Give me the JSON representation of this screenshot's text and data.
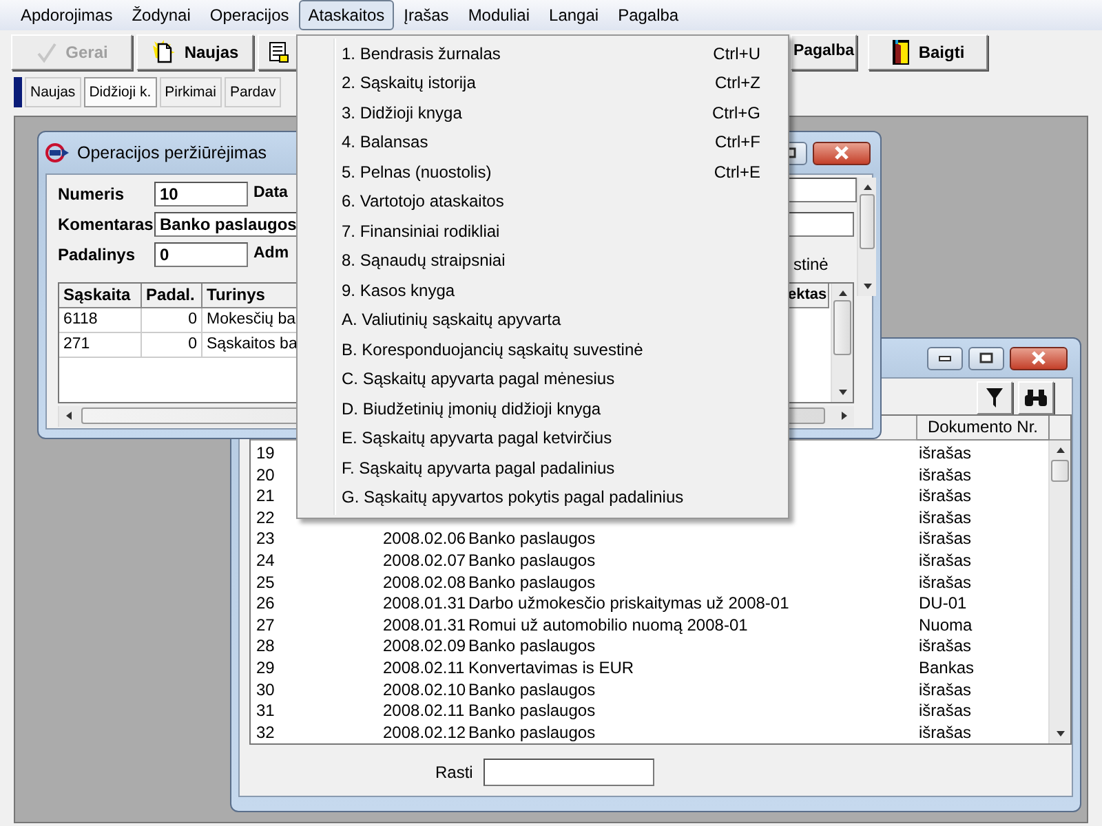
{
  "menu_bar": [
    {
      "label": "Apdorojimas",
      "selected": false
    },
    {
      "label": "Žodynai",
      "selected": false
    },
    {
      "label": "Operacijos",
      "selected": false
    },
    {
      "label": "Ataskaitos",
      "selected": true
    },
    {
      "label": "Įrašas",
      "selected": false
    },
    {
      "label": "Moduliai",
      "selected": false
    },
    {
      "label": "Langai",
      "selected": false
    },
    {
      "label": "Pagalba",
      "selected": false
    }
  ],
  "toolbar": [
    {
      "kind": "check",
      "label": "Gerai",
      "disabled": true
    },
    {
      "kind": "new",
      "label": "Naujas",
      "disabled": false
    },
    {
      "kind": "doc",
      "disabled": false
    },
    {
      "kind": "plain",
      "label": "Pagalba",
      "disabled": false
    },
    {
      "kind": "exit",
      "label": "Baigti",
      "disabled": false
    }
  ],
  "tabs": [
    {
      "label": "Naujas",
      "selected": false
    },
    {
      "label": "Didžioji k.",
      "selected": true
    },
    {
      "label": "Pirkimai",
      "selected": false
    },
    {
      "label": "Pardav",
      "selected": false
    }
  ],
  "report_menu": [
    {
      "label": "1. Bendrasis žurnalas",
      "shortcut": "Ctrl+U"
    },
    {
      "label": "2. Sąskaitų istorija",
      "shortcut": "Ctrl+Z"
    },
    {
      "label": "3. Didžioji knyga",
      "shortcut": "Ctrl+G"
    },
    {
      "label": "4. Balansas",
      "shortcut": "Ctrl+F"
    },
    {
      "label": "5. Pelnas (nuostolis)",
      "shortcut": "Ctrl+E"
    },
    {
      "label": "6. Vartotojo ataskaitos"
    },
    {
      "label": "7. Finansiniai rodikliai"
    },
    {
      "label": "8. Sąnaudų straipsniai"
    },
    {
      "label": "9. Kasos knyga"
    },
    {
      "label": "A. Valiutinių sąskaitų apyvarta"
    },
    {
      "label": "B. Koresponduojancių sąskaitų suvestinė"
    },
    {
      "label": "C. Sąskaitų apyvarta pagal mėnesius"
    },
    {
      "label": "D. Biudžetinių įmonių didžioji knyga"
    },
    {
      "label": "E. Sąskaitų apyvarta pagal ketvirčius"
    },
    {
      "label": "F. Sąskaitų apyvarta pagal padalinius"
    },
    {
      "label": "G. Sąskaitų apyvartos pokytis pagal padalinius"
    }
  ],
  "operation_window": {
    "title": "Operacijos peržiūrėjimas",
    "fields": [
      {
        "label": "Numeris",
        "value": "10",
        "side_label": "Data"
      },
      {
        "label": "Komentaras",
        "value": "Banko paslaugos"
      },
      {
        "label": "Padalinys",
        "value": "0",
        "side_label": "Adm"
      }
    ],
    "side_text": "stinė",
    "columns": [
      "Sąskaita",
      "Padal.",
      "Turinys",
      "ektas"
    ],
    "rows": [
      [
        "6118",
        "0",
        "Mokesčių ba"
      ],
      [
        "271",
        "0",
        "Sąskaitos ba"
      ]
    ]
  },
  "list_window": {
    "columns": [
      "Dokumento Nr."
    ],
    "rows": [
      {
        "number": "19",
        "document": "išrašas"
      },
      {
        "number": "20",
        "document": "išrašas"
      },
      {
        "number": "21",
        "document": "išrašas"
      },
      {
        "number": "22",
        "document": "išrašas"
      },
      {
        "number": "23",
        "date": "2008.02.06",
        "description": "Banko paslaugos",
        "document": "išrašas"
      },
      {
        "number": "24",
        "date": "2008.02.07",
        "description": "Banko paslaugos",
        "document": "išrašas"
      },
      {
        "number": "25",
        "date": "2008.02.08",
        "description": "Banko paslaugos",
        "document": "išrašas"
      },
      {
        "number": "26",
        "date": "2008.01.31",
        "description": "Darbo užmokesčio priskaitymas už 2008-01",
        "document": "DU-01"
      },
      {
        "number": "27",
        "date": "2008.01.31",
        "description": "Romui už automobilio nuomą 2008-01",
        "document": "Nuoma"
      },
      {
        "number": "28",
        "date": "2008.02.09",
        "description": "Banko paslaugos",
        "document": "išrašas"
      },
      {
        "number": "29",
        "date": "2008.02.11",
        "description": "Konvertavimas is EUR",
        "document": "Bankas"
      },
      {
        "number": "30",
        "date": "2008.02.10",
        "description": "Banko paslaugos",
        "document": "išrašas"
      },
      {
        "number": "31",
        "date": "2008.02.11",
        "description": "Banko paslaugos",
        "document": "išrašas"
      },
      {
        "number": "32",
        "date": "2008.02.12",
        "description": "Banko paslaugos",
        "document": "išrašas"
      }
    ],
    "search": {
      "label": "Rasti"
    }
  }
}
